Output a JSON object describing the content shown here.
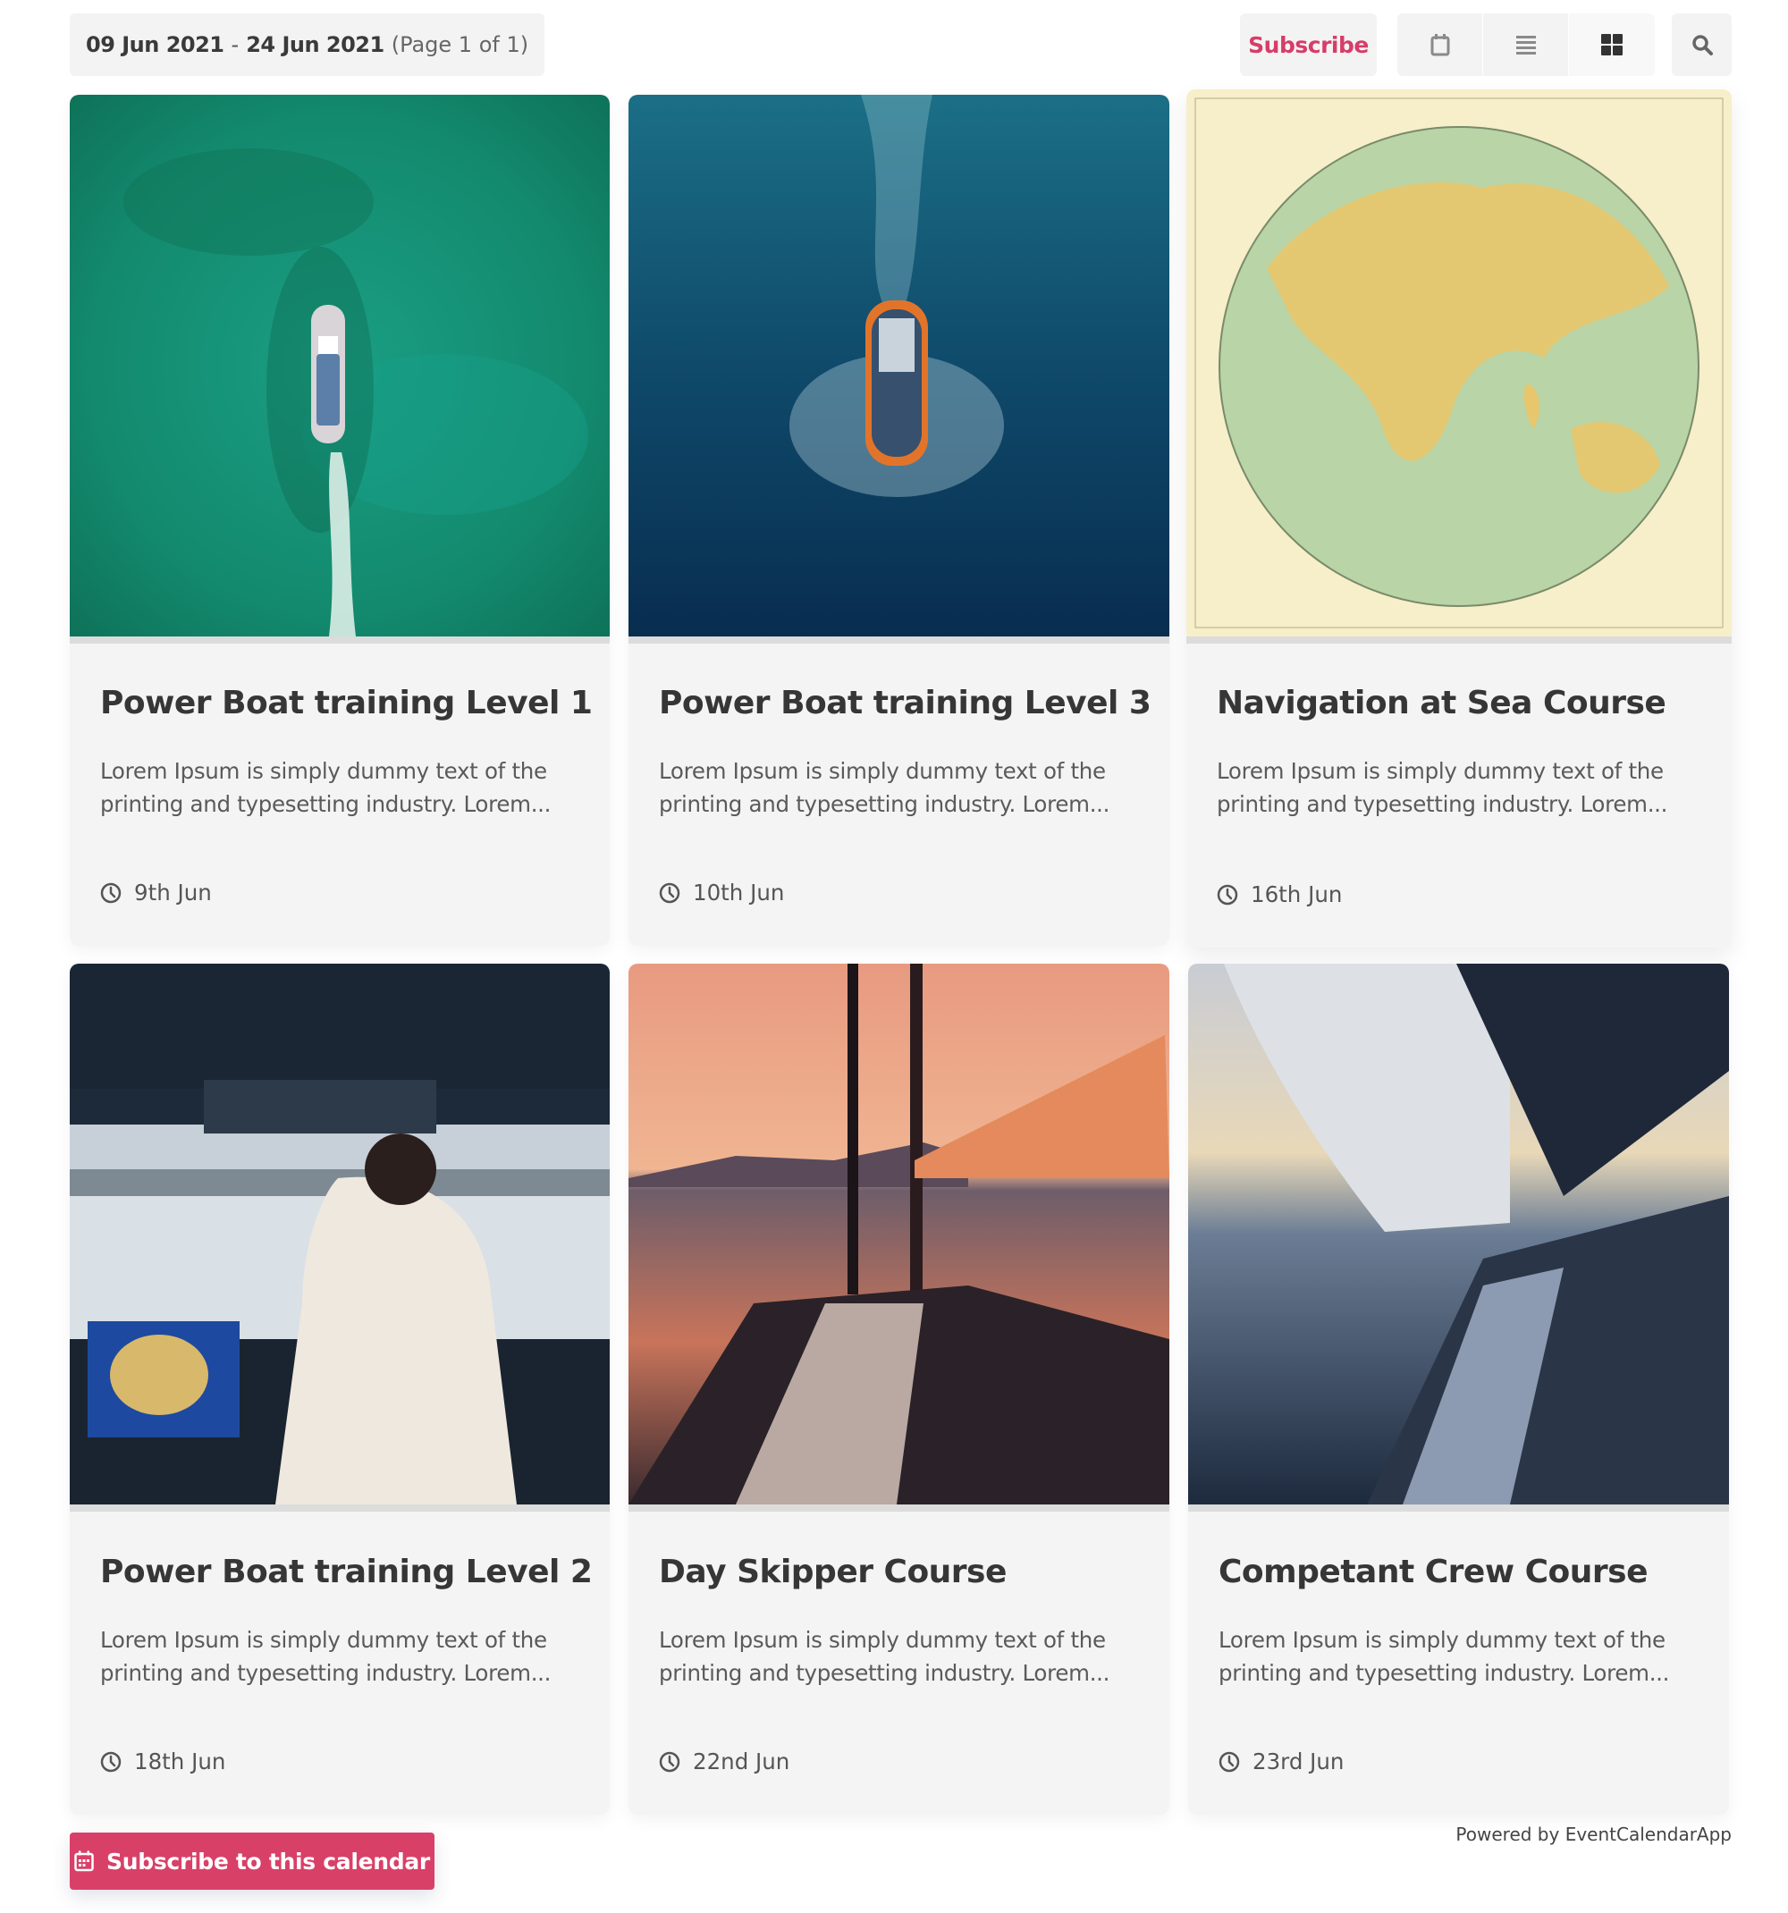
{
  "header": {
    "date_start": "09 Jun 2021",
    "date_separator": "-",
    "date_end": "24 Jun 2021",
    "page_info": "(Page 1 of 1)",
    "subscribe_label": "Subscribe",
    "views": [
      {
        "name": "calendar-view",
        "icon": "calendar-icon",
        "active": false
      },
      {
        "name": "list-view",
        "icon": "list-icon",
        "active": false
      },
      {
        "name": "grid-view",
        "icon": "grid-icon",
        "active": true
      }
    ],
    "search_icon": "search-icon"
  },
  "colors": {
    "accent": "#d94068",
    "subscribe_text": "#d63d68",
    "card_bg": "#f4f4f4",
    "pill_bg": "#f3f3f3"
  },
  "events": [
    {
      "title": "Power Boat training Level 1",
      "description": "Lorem Ipsum is simply dummy text of the printing and typesetting industry. Lorem...",
      "date": "9th Jun",
      "image": "aerial speedboat on turquoise sea"
    },
    {
      "title": "Power Boat training Level 3",
      "description": "Lorem Ipsum is simply dummy text of the printing and typesetting industry. Lorem...",
      "date": "10th Jun",
      "image": "aerial rescue boat on deep blue sea"
    },
    {
      "title": "Navigation at Sea Course",
      "description": "Lorem Ipsum is simply dummy text of the printing and typesetting industry. Lorem...",
      "date": "16th Jun",
      "image": "vintage map of the Indian Ocean hemisphere"
    },
    {
      "title": "Power Boat training Level 2",
      "description": "Lorem Ipsum is simply dummy text of the printing and typesetting industry. Lorem...",
      "date": "18th Jun",
      "image": "captain at ship bridge controls"
    },
    {
      "title": "Day Skipper Course",
      "description": "Lorem Ipsum is simply dummy text of the printing and typesetting industry. Lorem...",
      "date": "22nd Jun",
      "image": "sailboat deck at sunset"
    },
    {
      "title": "Competant Crew Course",
      "description": "Lorem Ipsum is simply dummy text of the printing and typesetting industry. Lorem...",
      "date": "23rd Jun",
      "image": "sailboat sail and bow at dusk"
    }
  ],
  "footer": {
    "subscribe_calendar_label": "Subscribe to this calendar",
    "powered_by": "Powered by EventCalendarApp"
  }
}
